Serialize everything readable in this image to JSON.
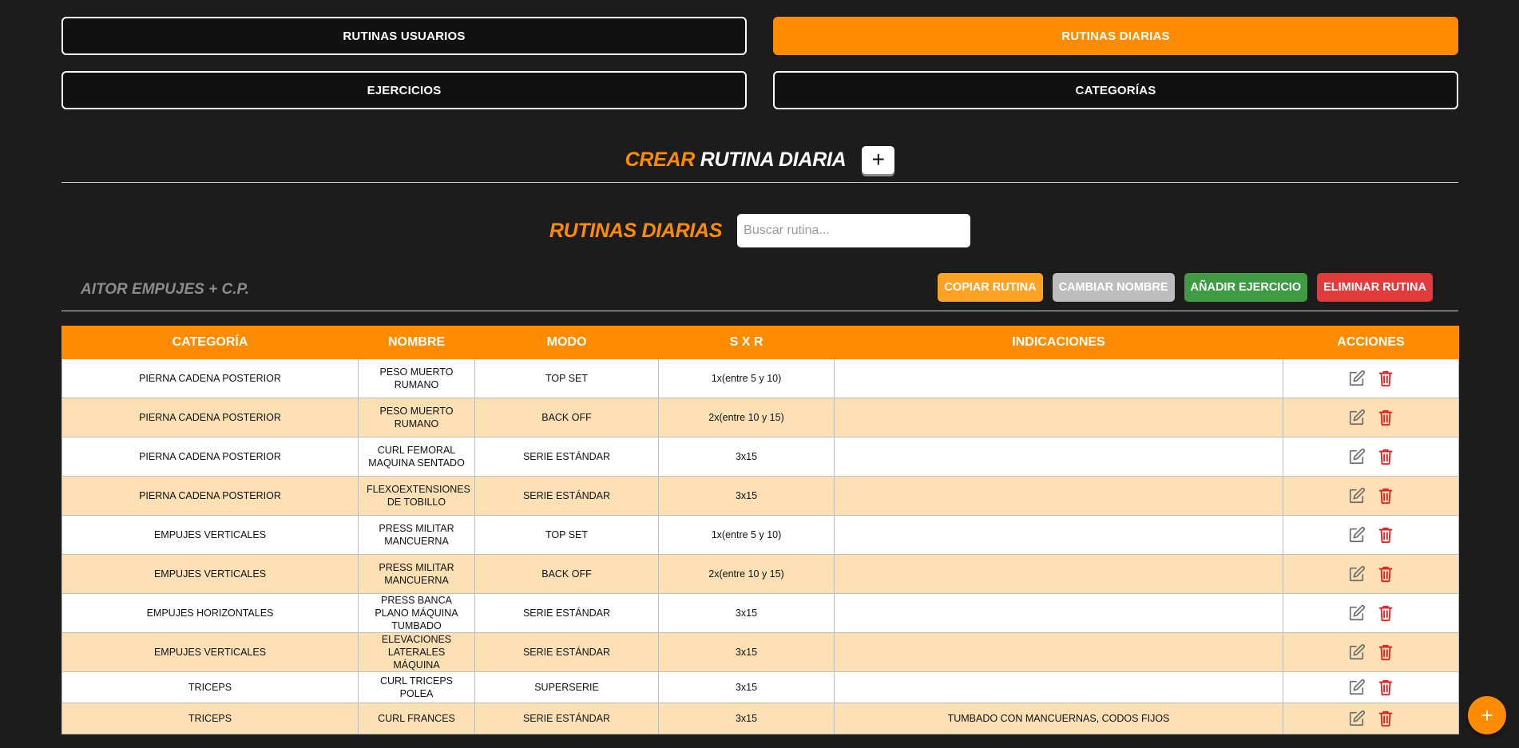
{
  "nav": {
    "items": [
      {
        "label": "RUTINAS USUARIOS",
        "active": false
      },
      {
        "label": "RUTINAS DIARIAS",
        "active": true
      },
      {
        "label": "EJERCICIOS",
        "active": false
      },
      {
        "label": "CATEGORÍAS",
        "active": false
      }
    ]
  },
  "create": {
    "accent": "CREAR",
    "rest": "RUTINA DIARIA",
    "plus_icon": "plus-icon"
  },
  "list": {
    "title": "RUTINAS DIARIAS",
    "search_placeholder": "Buscar rutina...",
    "search_value": ""
  },
  "routine": {
    "name": "AITOR EMPUJES + C.P.",
    "actions": [
      {
        "label": "COPIAR RUTINA",
        "color": "#ffa326"
      },
      {
        "label": "CAMBIAR NOMBRE",
        "color": "#bdbdbd"
      },
      {
        "label": "AÑADIR EJERCICIO",
        "color": "#3e9b44"
      },
      {
        "label": "ELIMINAR RUTINA",
        "color": "#e23b3b"
      }
    ]
  },
  "table": {
    "headers": [
      "CATEGORÍA",
      "NOMBRE",
      "MODO",
      "S X R",
      "INDICACIONES",
      "ACCIONES"
    ],
    "rows": [
      [
        "PIERNA CADENA POSTERIOR",
        "PESO MUERTO RUMANO",
        "TOP SET",
        "1x(entre 5 y 10)",
        ""
      ],
      [
        "PIERNA CADENA POSTERIOR",
        "PESO MUERTO RUMANO",
        "BACK OFF",
        "2x(entre 10 y 15)",
        ""
      ],
      [
        "PIERNA CADENA POSTERIOR",
        "CURL FEMORAL MAQUINA SENTADO",
        "SERIE ESTÁNDAR",
        "3x15",
        ""
      ],
      [
        "PIERNA CADENA POSTERIOR",
        "FLEXOEXTENSIONES DE TOBILLO",
        "SERIE ESTÁNDAR",
        "3x15",
        ""
      ],
      [
        "EMPUJES VERTICALES",
        "PRESS MILITAR MANCUERNA",
        "TOP SET",
        "1x(entre 5 y 10)",
        ""
      ],
      [
        "EMPUJES VERTICALES",
        "PRESS MILITAR MANCUERNA",
        "BACK OFF",
        "2x(entre 10 y 15)",
        ""
      ],
      [
        "EMPUJES HORIZONTALES",
        "PRESS BANCA PLANO MÁQUINA TUMBADO",
        "SERIE ESTÁNDAR",
        "3x15",
        ""
      ],
      [
        "EMPUJES VERTICALES",
        "ELEVACIONES LATERALES MÁQUINA",
        "SERIE ESTÁNDAR",
        "3x15",
        ""
      ],
      [
        "TRICEPS",
        "CURL TRICEPS POLEA",
        "SUPERSERIE",
        "3x15",
        ""
      ],
      [
        "TRICEPS",
        "CURL FRANCES",
        "SERIE ESTÁNDAR",
        "3x15",
        "TUMBADO CON MANCUERNAS, CODOS FIJOS"
      ]
    ],
    "row_icons": [
      "edit-icon",
      "trash-icon"
    ]
  },
  "fab": {
    "icon": "plus-icon"
  },
  "colors": {
    "accent": "#ff8c00",
    "background": "#1c1c1c",
    "row_alt": "#fde0b3",
    "delete": "#e02020"
  }
}
